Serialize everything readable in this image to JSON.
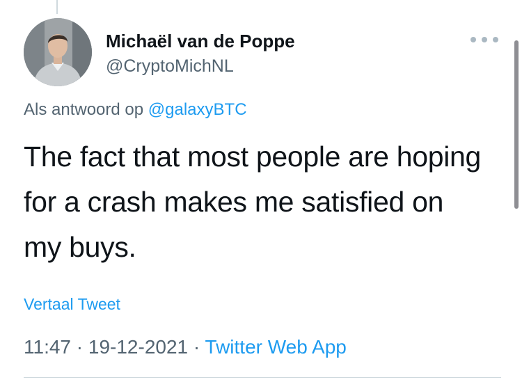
{
  "tweet": {
    "author": {
      "display_name": "Michaël van de Poppe",
      "handle": "@CryptoMichNL"
    },
    "reply_prefix": "Als antwoord op",
    "reply_to": "@galaxyBTC",
    "text": "The fact that most people are hoping for a crash makes me satisfied on my buys.",
    "translate_label": "Vertaal Tweet",
    "time": "11:47",
    "separator": "·",
    "date": "19-12-2021",
    "source": "Twitter Web App"
  },
  "icons": {
    "more": "more-horizontal-icon"
  },
  "colors": {
    "link": "#1d9bf0",
    "primary_text": "#0f1419",
    "secondary_text": "#536471"
  }
}
